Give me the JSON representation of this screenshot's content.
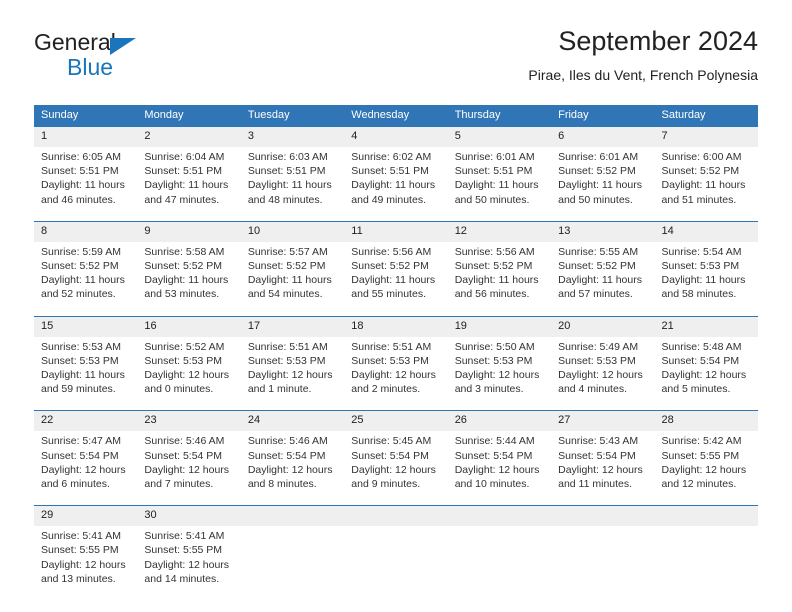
{
  "brand": {
    "name_top": "General",
    "name_bottom": "Blue",
    "triangle_color": "#1b75bc"
  },
  "header": {
    "title": "September 2024",
    "subtitle": "Pirae, Iles du Vent, French Polynesia",
    "accent_color": "#3075b6",
    "daynum_band_color": "#efefef"
  },
  "calendar": {
    "weekday_headers": [
      "Sunday",
      "Monday",
      "Tuesday",
      "Wednesday",
      "Thursday",
      "Friday",
      "Saturday"
    ],
    "weeks": [
      [
        {
          "day": "1",
          "sunrise": "Sunrise: 6:05 AM",
          "sunset": "Sunset: 5:51 PM",
          "daylight_1": "Daylight: 11 hours",
          "daylight_2": "and 46 minutes."
        },
        {
          "day": "2",
          "sunrise": "Sunrise: 6:04 AM",
          "sunset": "Sunset: 5:51 PM",
          "daylight_1": "Daylight: 11 hours",
          "daylight_2": "and 47 minutes."
        },
        {
          "day": "3",
          "sunrise": "Sunrise: 6:03 AM",
          "sunset": "Sunset: 5:51 PM",
          "daylight_1": "Daylight: 11 hours",
          "daylight_2": "and 48 minutes."
        },
        {
          "day": "4",
          "sunrise": "Sunrise: 6:02 AM",
          "sunset": "Sunset: 5:51 PM",
          "daylight_1": "Daylight: 11 hours",
          "daylight_2": "and 49 minutes."
        },
        {
          "day": "5",
          "sunrise": "Sunrise: 6:01 AM",
          "sunset": "Sunset: 5:51 PM",
          "daylight_1": "Daylight: 11 hours",
          "daylight_2": "and 50 minutes."
        },
        {
          "day": "6",
          "sunrise": "Sunrise: 6:01 AM",
          "sunset": "Sunset: 5:52 PM",
          "daylight_1": "Daylight: 11 hours",
          "daylight_2": "and 50 minutes."
        },
        {
          "day": "7",
          "sunrise": "Sunrise: 6:00 AM",
          "sunset": "Sunset: 5:52 PM",
          "daylight_1": "Daylight: 11 hours",
          "daylight_2": "and 51 minutes."
        }
      ],
      [
        {
          "day": "8",
          "sunrise": "Sunrise: 5:59 AM",
          "sunset": "Sunset: 5:52 PM",
          "daylight_1": "Daylight: 11 hours",
          "daylight_2": "and 52 minutes."
        },
        {
          "day": "9",
          "sunrise": "Sunrise: 5:58 AM",
          "sunset": "Sunset: 5:52 PM",
          "daylight_1": "Daylight: 11 hours",
          "daylight_2": "and 53 minutes."
        },
        {
          "day": "10",
          "sunrise": "Sunrise: 5:57 AM",
          "sunset": "Sunset: 5:52 PM",
          "daylight_1": "Daylight: 11 hours",
          "daylight_2": "and 54 minutes."
        },
        {
          "day": "11",
          "sunrise": "Sunrise: 5:56 AM",
          "sunset": "Sunset: 5:52 PM",
          "daylight_1": "Daylight: 11 hours",
          "daylight_2": "and 55 minutes."
        },
        {
          "day": "12",
          "sunrise": "Sunrise: 5:56 AM",
          "sunset": "Sunset: 5:52 PM",
          "daylight_1": "Daylight: 11 hours",
          "daylight_2": "and 56 minutes."
        },
        {
          "day": "13",
          "sunrise": "Sunrise: 5:55 AM",
          "sunset": "Sunset: 5:52 PM",
          "daylight_1": "Daylight: 11 hours",
          "daylight_2": "and 57 minutes."
        },
        {
          "day": "14",
          "sunrise": "Sunrise: 5:54 AM",
          "sunset": "Sunset: 5:53 PM",
          "daylight_1": "Daylight: 11 hours",
          "daylight_2": "and 58 minutes."
        }
      ],
      [
        {
          "day": "15",
          "sunrise": "Sunrise: 5:53 AM",
          "sunset": "Sunset: 5:53 PM",
          "daylight_1": "Daylight: 11 hours",
          "daylight_2": "and 59 minutes."
        },
        {
          "day": "16",
          "sunrise": "Sunrise: 5:52 AM",
          "sunset": "Sunset: 5:53 PM",
          "daylight_1": "Daylight: 12 hours",
          "daylight_2": "and 0 minutes."
        },
        {
          "day": "17",
          "sunrise": "Sunrise: 5:51 AM",
          "sunset": "Sunset: 5:53 PM",
          "daylight_1": "Daylight: 12 hours",
          "daylight_2": "and 1 minute."
        },
        {
          "day": "18",
          "sunrise": "Sunrise: 5:51 AM",
          "sunset": "Sunset: 5:53 PM",
          "daylight_1": "Daylight: 12 hours",
          "daylight_2": "and 2 minutes."
        },
        {
          "day": "19",
          "sunrise": "Sunrise: 5:50 AM",
          "sunset": "Sunset: 5:53 PM",
          "daylight_1": "Daylight: 12 hours",
          "daylight_2": "and 3 minutes."
        },
        {
          "day": "20",
          "sunrise": "Sunrise: 5:49 AM",
          "sunset": "Sunset: 5:53 PM",
          "daylight_1": "Daylight: 12 hours",
          "daylight_2": "and 4 minutes."
        },
        {
          "day": "21",
          "sunrise": "Sunrise: 5:48 AM",
          "sunset": "Sunset: 5:54 PM",
          "daylight_1": "Daylight: 12 hours",
          "daylight_2": "and 5 minutes."
        }
      ],
      [
        {
          "day": "22",
          "sunrise": "Sunrise: 5:47 AM",
          "sunset": "Sunset: 5:54 PM",
          "daylight_1": "Daylight: 12 hours",
          "daylight_2": "and 6 minutes."
        },
        {
          "day": "23",
          "sunrise": "Sunrise: 5:46 AM",
          "sunset": "Sunset: 5:54 PM",
          "daylight_1": "Daylight: 12 hours",
          "daylight_2": "and 7 minutes."
        },
        {
          "day": "24",
          "sunrise": "Sunrise: 5:46 AM",
          "sunset": "Sunset: 5:54 PM",
          "daylight_1": "Daylight: 12 hours",
          "daylight_2": "and 8 minutes."
        },
        {
          "day": "25",
          "sunrise": "Sunrise: 5:45 AM",
          "sunset": "Sunset: 5:54 PM",
          "daylight_1": "Daylight: 12 hours",
          "daylight_2": "and 9 minutes."
        },
        {
          "day": "26",
          "sunrise": "Sunrise: 5:44 AM",
          "sunset": "Sunset: 5:54 PM",
          "daylight_1": "Daylight: 12 hours",
          "daylight_2": "and 10 minutes."
        },
        {
          "day": "27",
          "sunrise": "Sunrise: 5:43 AM",
          "sunset": "Sunset: 5:54 PM",
          "daylight_1": "Daylight: 12 hours",
          "daylight_2": "and 11 minutes."
        },
        {
          "day": "28",
          "sunrise": "Sunrise: 5:42 AM",
          "sunset": "Sunset: 5:55 PM",
          "daylight_1": "Daylight: 12 hours",
          "daylight_2": "and 12 minutes."
        }
      ],
      [
        {
          "day": "29",
          "sunrise": "Sunrise: 5:41 AM",
          "sunset": "Sunset: 5:55 PM",
          "daylight_1": "Daylight: 12 hours",
          "daylight_2": "and 13 minutes."
        },
        {
          "day": "30",
          "sunrise": "Sunrise: 5:41 AM",
          "sunset": "Sunset: 5:55 PM",
          "daylight_1": "Daylight: 12 hours",
          "daylight_2": "and 14 minutes."
        },
        {
          "day": "",
          "sunrise": "",
          "sunset": "",
          "daylight_1": "",
          "daylight_2": ""
        },
        {
          "day": "",
          "sunrise": "",
          "sunset": "",
          "daylight_1": "",
          "daylight_2": ""
        },
        {
          "day": "",
          "sunrise": "",
          "sunset": "",
          "daylight_1": "",
          "daylight_2": ""
        },
        {
          "day": "",
          "sunrise": "",
          "sunset": "",
          "daylight_1": "",
          "daylight_2": ""
        },
        {
          "day": "",
          "sunrise": "",
          "sunset": "",
          "daylight_1": "",
          "daylight_2": ""
        }
      ]
    ]
  }
}
